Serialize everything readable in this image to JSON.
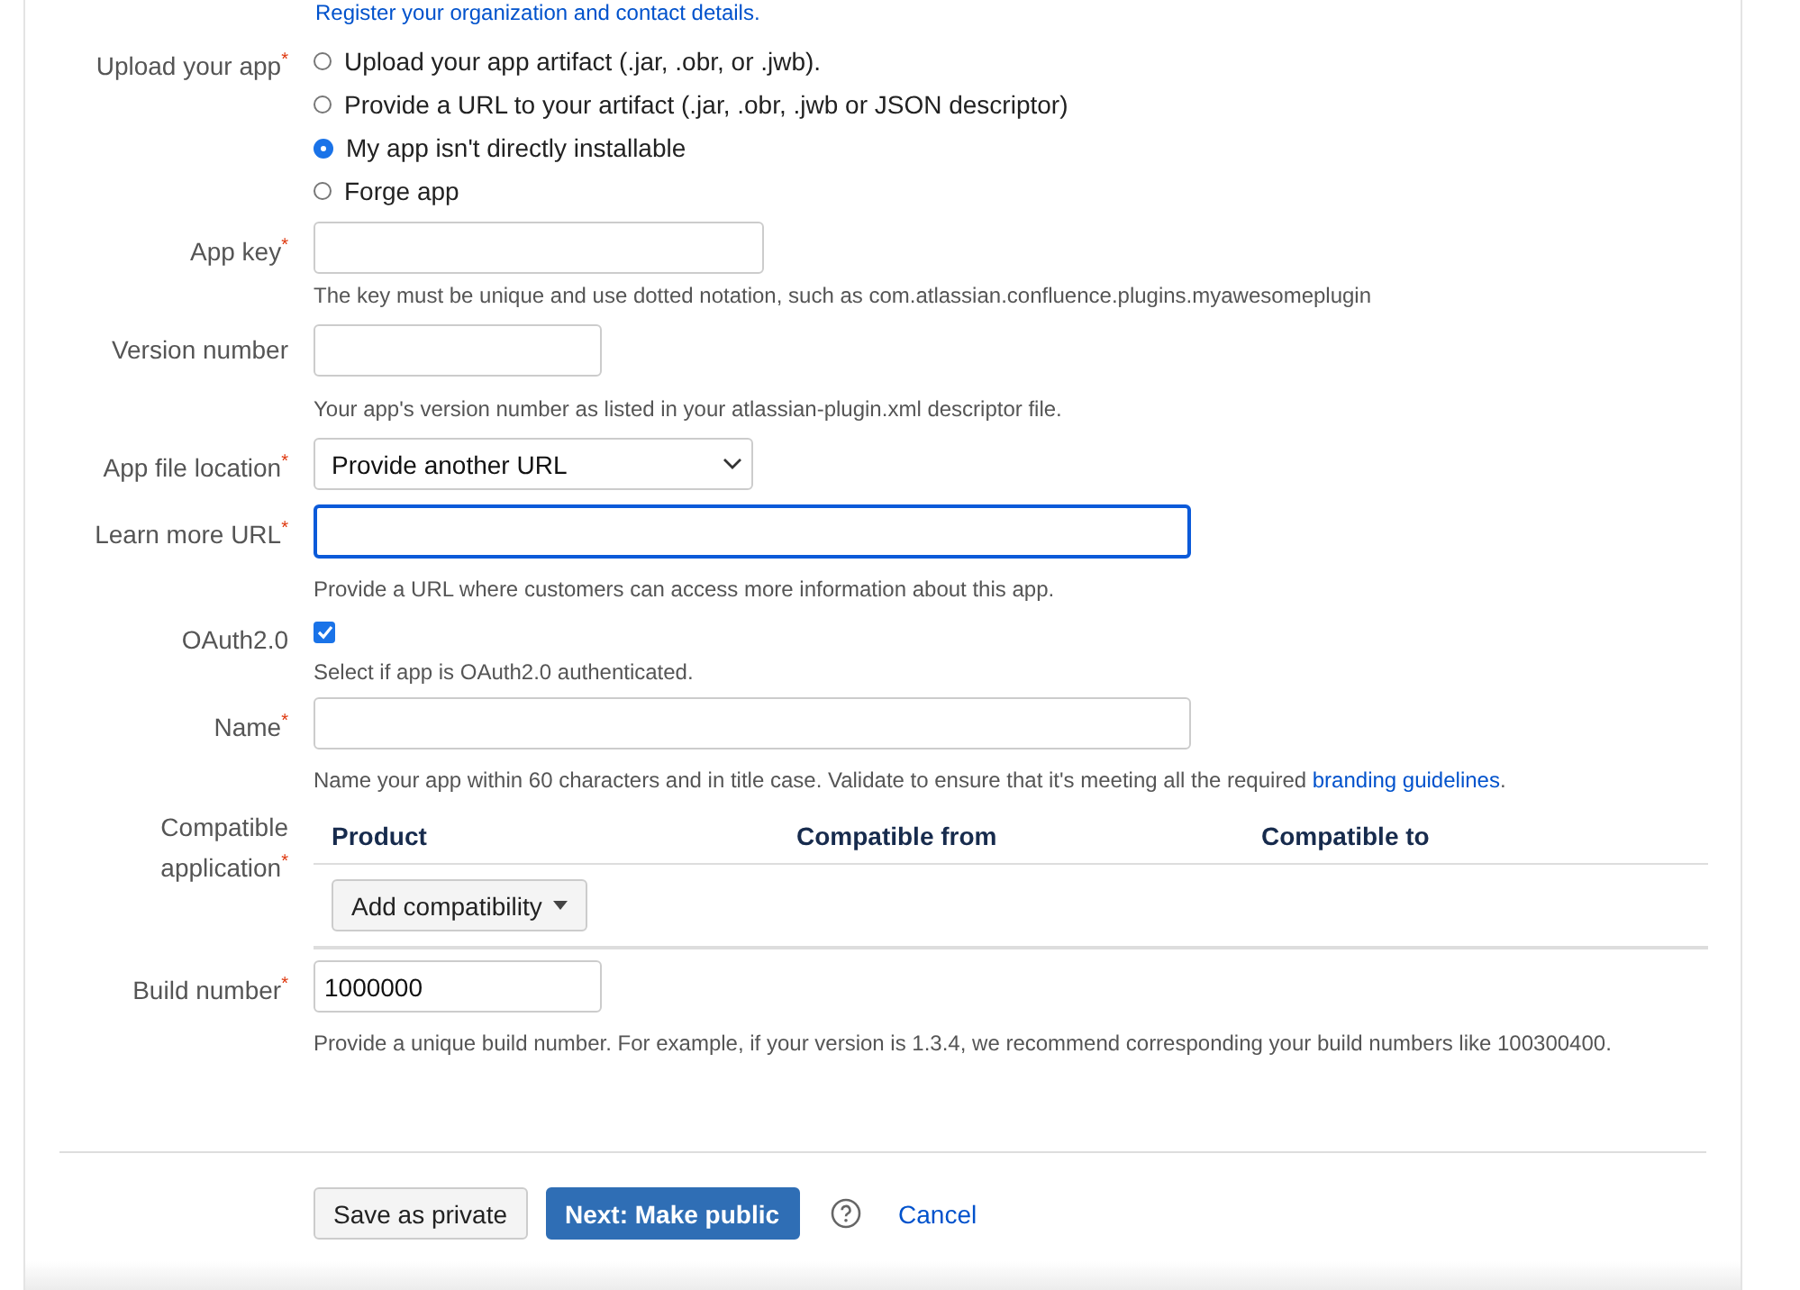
{
  "intro_link": "Register your organization and contact details.",
  "fields": [
    {
      "kind": "radio",
      "label": "Upload your app",
      "required_mark": "*",
      "options": [
        {
          "label": "Upload your app artifact (.jar, .obr, or .jwb).",
          "selected": false
        },
        {
          "label": "Provide a URL to your artifact (.jar, .obr, .jwb or JSON descriptor)",
          "selected": false
        },
        {
          "label": "My app isn't directly installable",
          "selected": true
        },
        {
          "label": "Forge app",
          "selected": false
        }
      ]
    },
    {
      "kind": "text",
      "label": "App key",
      "required_mark": "*",
      "focused": false,
      "help": "The key must be unique and use dotted notation, such as com.atlassian.confluence.plugins.myawesomeplugin"
    },
    {
      "kind": "text",
      "label": "Version number",
      "focused": false,
      "help": "Your app's version number as listed in your atlassian-plugin.xml descriptor file."
    },
    {
      "kind": "select",
      "label": "App file location",
      "required_mark": "*",
      "value": "Provide another URL"
    },
    {
      "kind": "text",
      "label": "Learn more URL",
      "required_mark": "*",
      "focused": true,
      "help": "Provide a URL where customers can access more information about this app."
    },
    {
      "kind": "checkbox",
      "label": "OAuth2.0",
      "checked": true,
      "help": "Select if app is OAuth2.0 authenticated."
    },
    {
      "kind": "text",
      "label": "Name",
      "required_mark": "*",
      "focused": false,
      "help": "Name your app within 60 characters and in title case. Validate to ensure that it's meeting all the required ",
      "link": "branding guidelines",
      "help_end": "."
    },
    {
      "kind": "table",
      "label": "Compatible\napplication",
      "required_mark": "*",
      "columns": [
        "Product",
        "Compatible from",
        "Compatible to"
      ],
      "button": "Add compatibility"
    },
    {
      "kind": "text",
      "label": "Build number",
      "required_mark": "*",
      "focused": false,
      "value": "1000000",
      "help": "Provide a unique build number. For example, if your version is 1.3.4, we recommend corresponding your build numbers like 100300400."
    }
  ],
  "actions": [
    {
      "kind": "secondary",
      "label": "Save as private"
    },
    {
      "kind": "primary",
      "label": "Next: Make public"
    },
    {
      "kind": "help"
    },
    {
      "kind": "link",
      "label": "Cancel"
    }
  ]
}
